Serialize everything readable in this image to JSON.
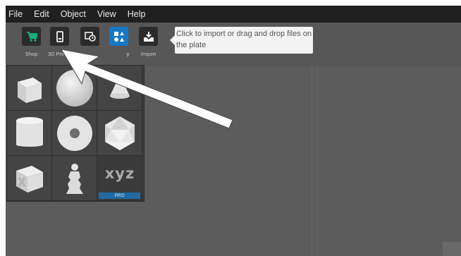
{
  "menu": [
    "File",
    "Edit",
    "Object",
    "View",
    "Help"
  ],
  "toolbar": {
    "tools": [
      {
        "label": "Shop",
        "icon": "cart-icon"
      },
      {
        "label": "3D Printer",
        "icon": "printer-icon"
      },
      {
        "label": "",
        "icon": "history-icon"
      },
      {
        "label": "y",
        "icon": "library-icon",
        "active": true
      },
      {
        "label": "Import",
        "icon": "import-icon"
      }
    ],
    "tooltip": "Click to import or drag and drop files on the plate"
  },
  "library": {
    "items": [
      {
        "name": "cube"
      },
      {
        "name": "sphere"
      },
      {
        "name": "cone"
      },
      {
        "name": "cylinder"
      },
      {
        "name": "torus"
      },
      {
        "name": "icosahedron"
      },
      {
        "name": "calibration-cube"
      },
      {
        "name": "figurine"
      },
      {
        "name": "xyz-logo",
        "text": "xyz",
        "badge": "PRO"
      }
    ]
  },
  "colors": {
    "menubar": "#202020",
    "toolbar": "#575757",
    "viewport": "#5c5c5c",
    "active_button": "#1677c5",
    "shop_icon": "#16b07a",
    "pro_badge": "#1f6aa3"
  }
}
